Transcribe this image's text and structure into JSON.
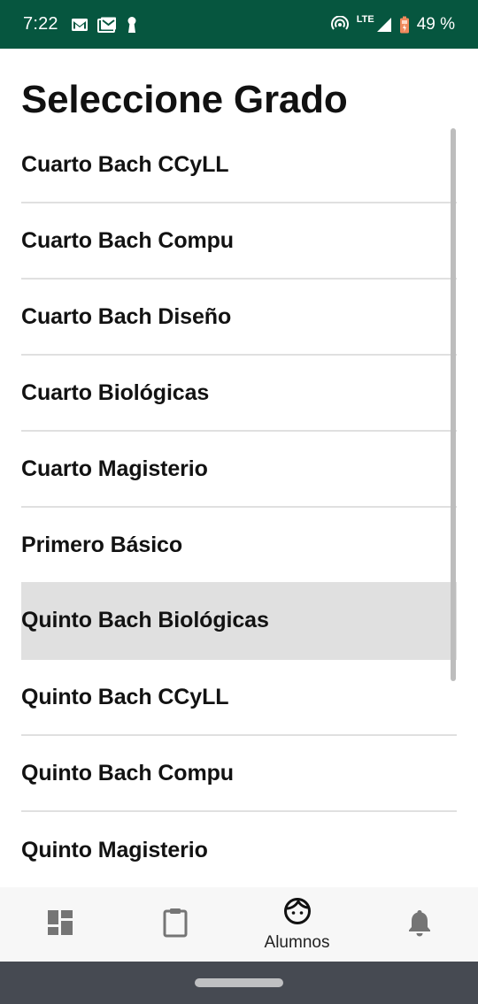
{
  "status_bar": {
    "time": "7:22",
    "left_icons": [
      "gmail-icon",
      "mail-icon",
      "keyhole-icon"
    ],
    "right_icons": [
      "hotspot-icon",
      "signal-icon",
      "battery-icon"
    ],
    "network": "LTE",
    "battery": "49 %",
    "background_color": "#06563f"
  },
  "header": {
    "title": "Seleccione Grado"
  },
  "list": {
    "items": [
      {
        "label": "Cuarto Bach CCyLL"
      },
      {
        "label": "Cuarto Bach Compu"
      },
      {
        "label": "Cuarto Bach Diseño"
      },
      {
        "label": "Cuarto Biológicas"
      },
      {
        "label": "Cuarto Magisterio"
      },
      {
        "label": "Primero Básico"
      },
      {
        "label": "Quinto Bach Biológicas",
        "selected": true
      },
      {
        "label": "Quinto Bach CCyLL"
      },
      {
        "label": "Quinto Bach Compu"
      },
      {
        "label": "Quinto Magisterio"
      }
    ],
    "selected_color": "#e0e0e0"
  },
  "bottom_nav": {
    "items": [
      {
        "icon": "dashboard-icon"
      },
      {
        "icon": "clipboard-icon"
      },
      {
        "icon": "face-icon",
        "label": "Alumnos",
        "active": true
      },
      {
        "icon": "bell-icon"
      }
    ]
  }
}
